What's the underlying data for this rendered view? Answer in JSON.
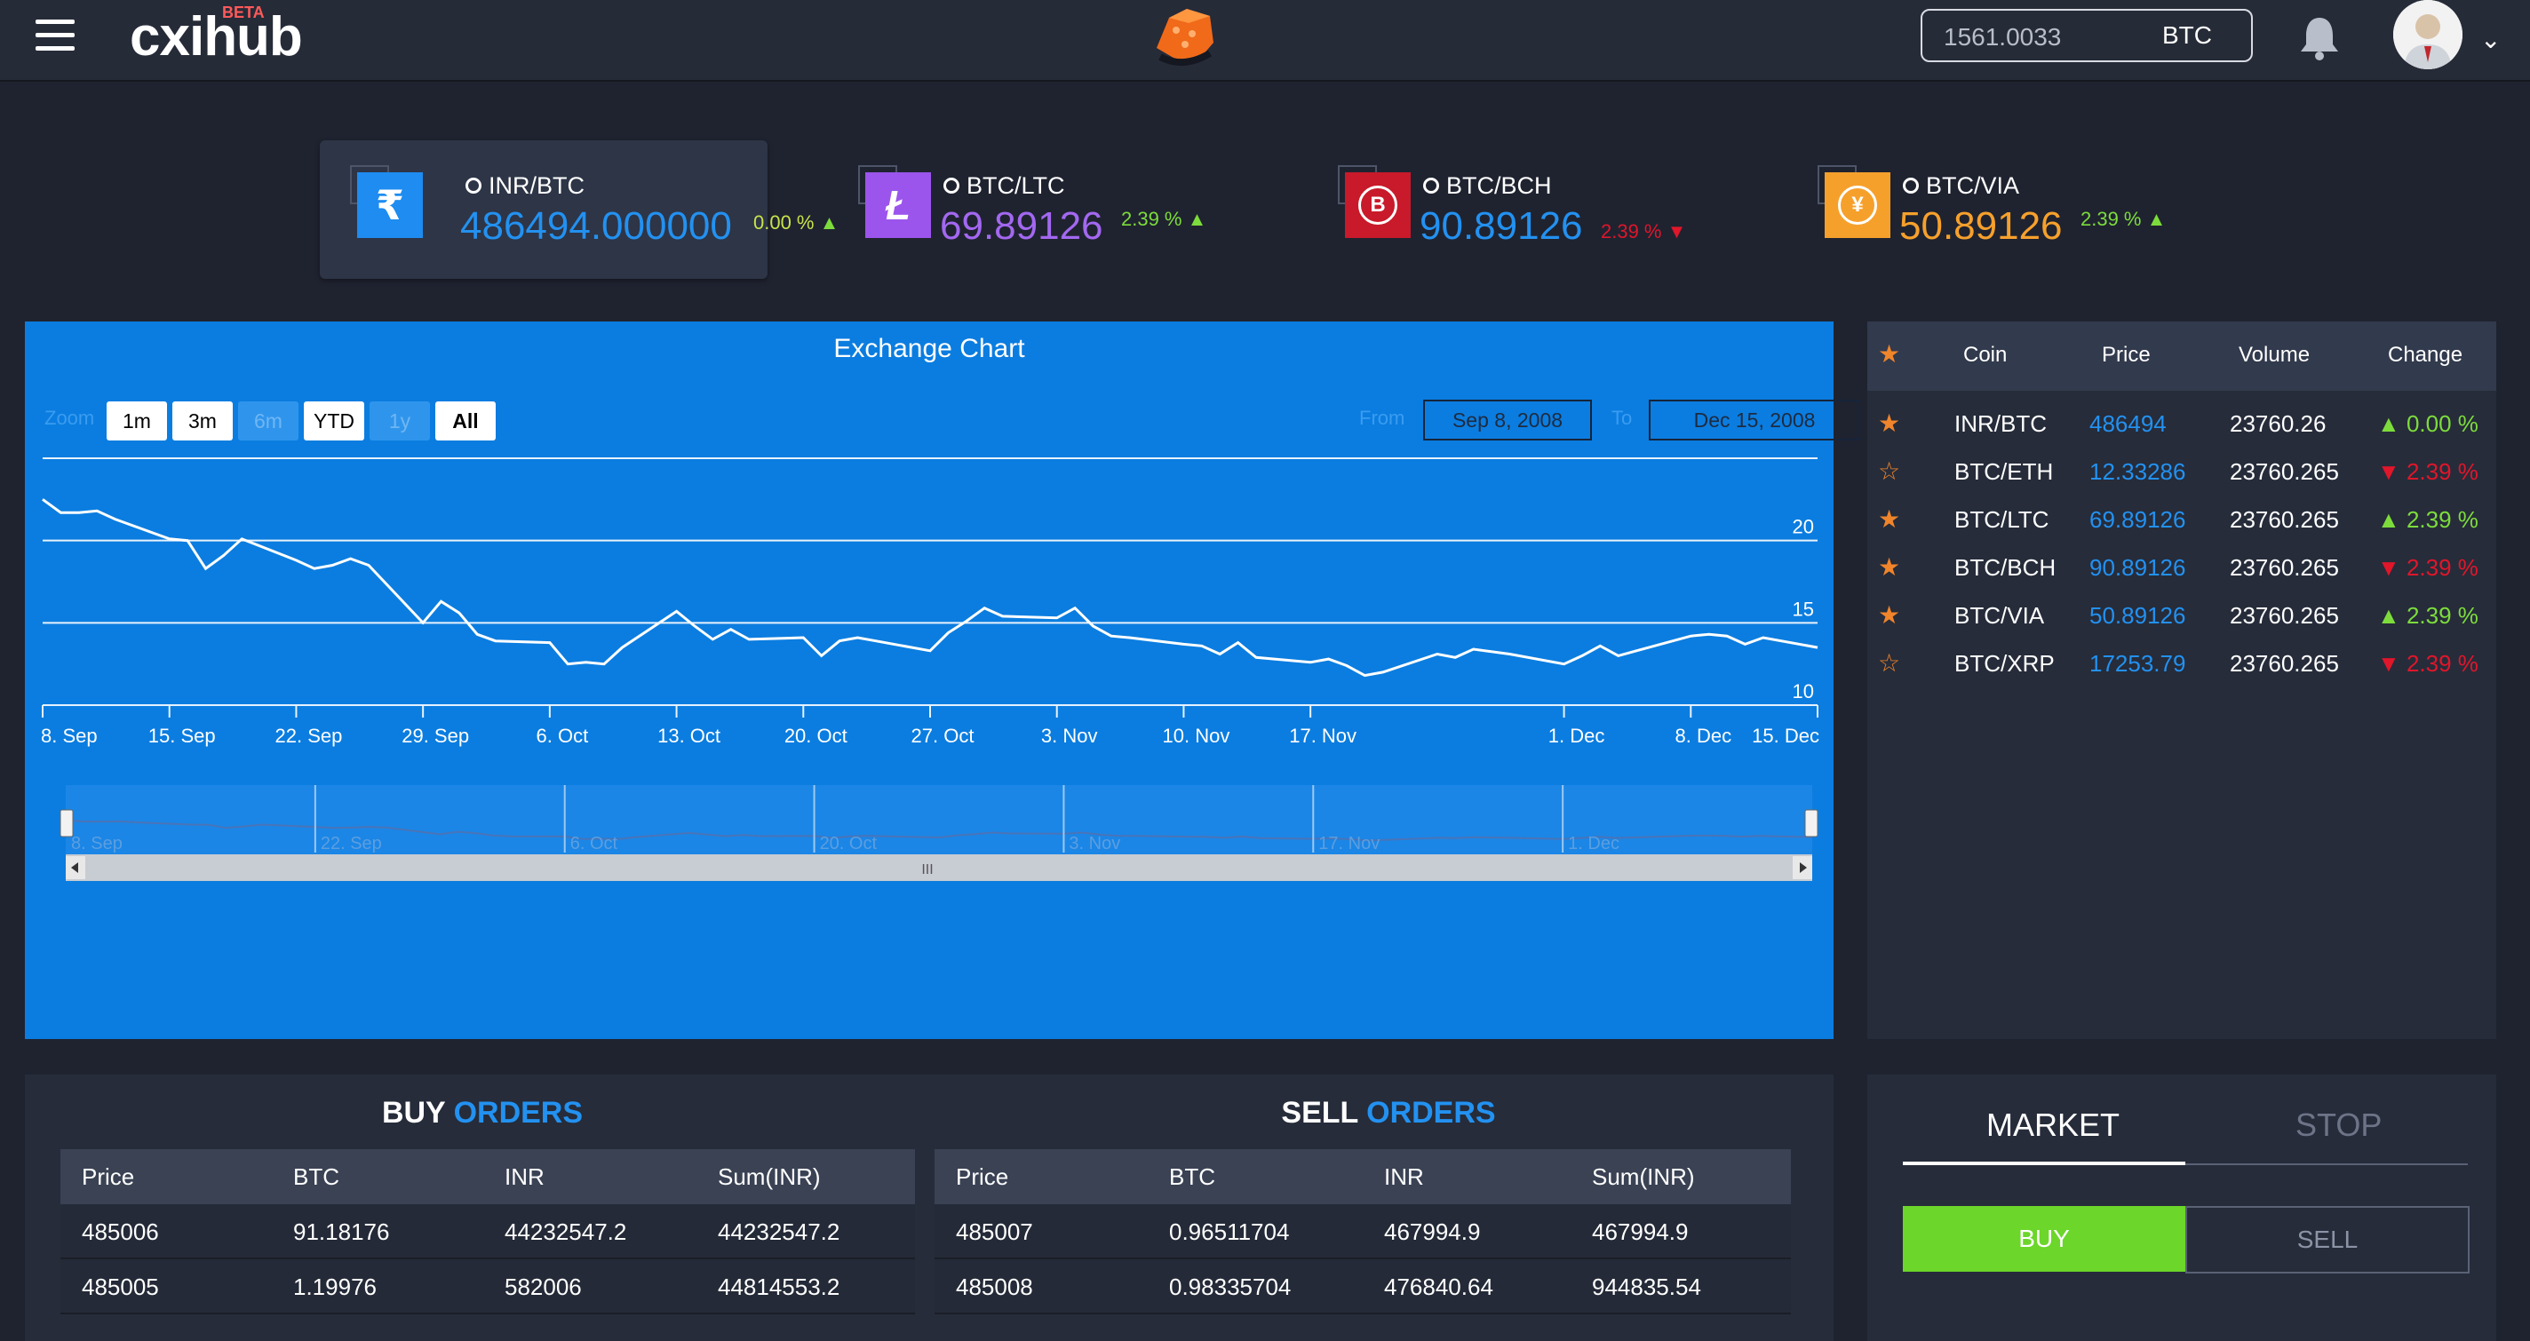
{
  "header": {
    "logo": "cxihub",
    "beta": "BETA",
    "balance_value": "1561.0033",
    "balance_currency": "BTC"
  },
  "tickers": [
    {
      "pair": "INR/BTC",
      "price": "486494.000000",
      "change": "0.00 %",
      "direction": "up",
      "icon": "rupee-icon",
      "color": "#1e8cf0",
      "price_color": "#2391f0"
    },
    {
      "pair": "BTC/LTC",
      "price": "69.89126",
      "change": "2.39 %",
      "direction": "up",
      "icon": "litecoin-icon",
      "color": "#9b55ec",
      "price_color": "#a368f0"
    },
    {
      "pair": "BTC/BCH",
      "price": "90.89126",
      "change": "2.39 %",
      "direction": "down",
      "icon": "bitcoin-cash-icon",
      "color": "#c81a2a",
      "price_color": "#2391f0"
    },
    {
      "pair": "BTC/VIA",
      "price": "50.89126",
      "change": "2.39 %",
      "direction": "up",
      "icon": "yen-icon",
      "color": "#f6a02c",
      "price_color": "#f6a02c"
    }
  ],
  "chart": {
    "title": "Exchange Chart",
    "zoom_label": "Zoom",
    "zoom_buttons": [
      "1m",
      "3m",
      "6m",
      "YTD",
      "1y",
      "All"
    ],
    "from_label": "From",
    "from_value": "Sep 8, 2008",
    "to_label": "To",
    "to_value": "Dec 15, 2008",
    "navigator_labels": [
      "8. Sep",
      "22. Sep",
      "6. Oct",
      "20. Oct",
      "3. Nov",
      "17. Nov",
      "1. Dec"
    ],
    "scrollbar_grip": "III"
  },
  "chart_data": {
    "type": "line",
    "title": "Exchange Chart",
    "x_tick_labels": [
      "8. Sep",
      "15. Sep",
      "22. Sep",
      "29. Sep",
      "6. Oct",
      "13. Oct",
      "20. Oct",
      "27. Oct",
      "3. Nov",
      "10. Nov",
      "17. Nov",
      "1. Dec",
      "8. Dec",
      "15. Dec"
    ],
    "y_tick_labels": [
      "10",
      "15",
      "20"
    ],
    "ylim": [
      10,
      25
    ],
    "x_range": [
      "2008-09-08",
      "2008-12-15"
    ],
    "grid": "horizontal",
    "series": [
      {
        "x": [
          "2008-09-08",
          "2008-09-09",
          "2008-09-10",
          "2008-09-11",
          "2008-09-12",
          "2008-09-15",
          "2008-09-16",
          "2008-09-17",
          "2008-09-18",
          "2008-09-19",
          "2008-09-22",
          "2008-09-23",
          "2008-09-24",
          "2008-09-25",
          "2008-09-26",
          "2008-09-29",
          "2008-09-30",
          "2008-10-01",
          "2008-10-02",
          "2008-10-03",
          "2008-10-06",
          "2008-10-07",
          "2008-10-08",
          "2008-10-09",
          "2008-10-10",
          "2008-10-13",
          "2008-10-14",
          "2008-10-15",
          "2008-10-16",
          "2008-10-17",
          "2008-10-20",
          "2008-10-21",
          "2008-10-22",
          "2008-10-23",
          "2008-10-24",
          "2008-10-27",
          "2008-10-28",
          "2008-10-29",
          "2008-10-30",
          "2008-10-31",
          "2008-11-03",
          "2008-11-04",
          "2008-11-05",
          "2008-11-06",
          "2008-11-07",
          "2008-11-10",
          "2008-11-11",
          "2008-11-12",
          "2008-11-13",
          "2008-11-14",
          "2008-11-17",
          "2008-11-18",
          "2008-11-19",
          "2008-11-20",
          "2008-11-21",
          "2008-11-24",
          "2008-11-25",
          "2008-11-26",
          "2008-11-28",
          "2008-12-01",
          "2008-12-02",
          "2008-12-03",
          "2008-12-04",
          "2008-12-05",
          "2008-12-08",
          "2008-12-09",
          "2008-12-10",
          "2008-12-11",
          "2008-12-12",
          "2008-12-15"
        ],
        "y": [
          22.5,
          21.7,
          21.7,
          21.8,
          21.3,
          20.1,
          20.0,
          18.3,
          19.1,
          20.1,
          18.8,
          18.3,
          18.5,
          18.9,
          18.5,
          15.0,
          16.3,
          15.6,
          14.3,
          13.9,
          13.8,
          12.5,
          12.6,
          12.5,
          13.5,
          15.7,
          14.8,
          14.0,
          14.6,
          14.0,
          14.1,
          13.0,
          13.9,
          14.1,
          13.9,
          13.3,
          14.4,
          15.1,
          15.9,
          15.4,
          15.3,
          15.9,
          14.8,
          14.2,
          14.1,
          13.7,
          13.6,
          13.1,
          13.8,
          12.9,
          12.6,
          12.8,
          12.4,
          11.8,
          12.0,
          13.1,
          12.9,
          13.4,
          13.1,
          12.5,
          13.0,
          13.6,
          13.0,
          13.3,
          14.2,
          14.3,
          14.2,
          13.7,
          14.1,
          13.5
        ]
      }
    ]
  },
  "market_table": {
    "headers": [
      "Coin",
      "Price",
      "Volume",
      "Change"
    ],
    "rows": [
      {
        "coin": "INR/BTC",
        "price": "486494",
        "volume": "23760.26",
        "change": "0.00 %",
        "direction": "up",
        "starred": true
      },
      {
        "coin": "BTC/ETH",
        "price": "12.33286",
        "volume": "23760.265",
        "change": "2.39 %",
        "direction": "down",
        "starred": false
      },
      {
        "coin": "BTC/LTC",
        "price": "69.89126",
        "volume": "23760.265",
        "change": "2.39 %",
        "direction": "up",
        "starred": true
      },
      {
        "coin": "BTC/BCH",
        "price": "90.89126",
        "volume": "23760.265",
        "change": "2.39 %",
        "direction": "down",
        "starred": true
      },
      {
        "coin": "BTC/VIA",
        "price": "50.89126",
        "volume": "23760.265",
        "change": "2.39 %",
        "direction": "up",
        "starred": true
      },
      {
        "coin": "BTC/XRP",
        "price": "17253.79",
        "volume": "23760.265",
        "change": "2.39 %",
        "direction": "down",
        "starred": false
      }
    ]
  },
  "buy_orders": {
    "title_a": "BUY",
    "title_b": "ORDERS",
    "headers": [
      "Price",
      "BTC",
      "INR",
      "Sum(INR)"
    ],
    "rows": [
      [
        "485006",
        "91.18176",
        "44232547.2",
        "44232547.2"
      ],
      [
        "485005",
        "1.19976",
        "582006",
        "44814553.2"
      ]
    ]
  },
  "sell_orders": {
    "title_a": "SELL",
    "title_b": "ORDERS",
    "headers": [
      "Price",
      "BTC",
      "INR",
      "Sum(INR)"
    ],
    "rows": [
      [
        "485007",
        "0.96511704",
        "467994.9",
        "467994.9"
      ],
      [
        "485008",
        "0.98335704",
        "476840.64",
        "944835.54"
      ]
    ]
  },
  "trade": {
    "tab_market": "MARKET",
    "tab_stop": "STOP",
    "buy": "BUY",
    "sell": "SELL"
  }
}
